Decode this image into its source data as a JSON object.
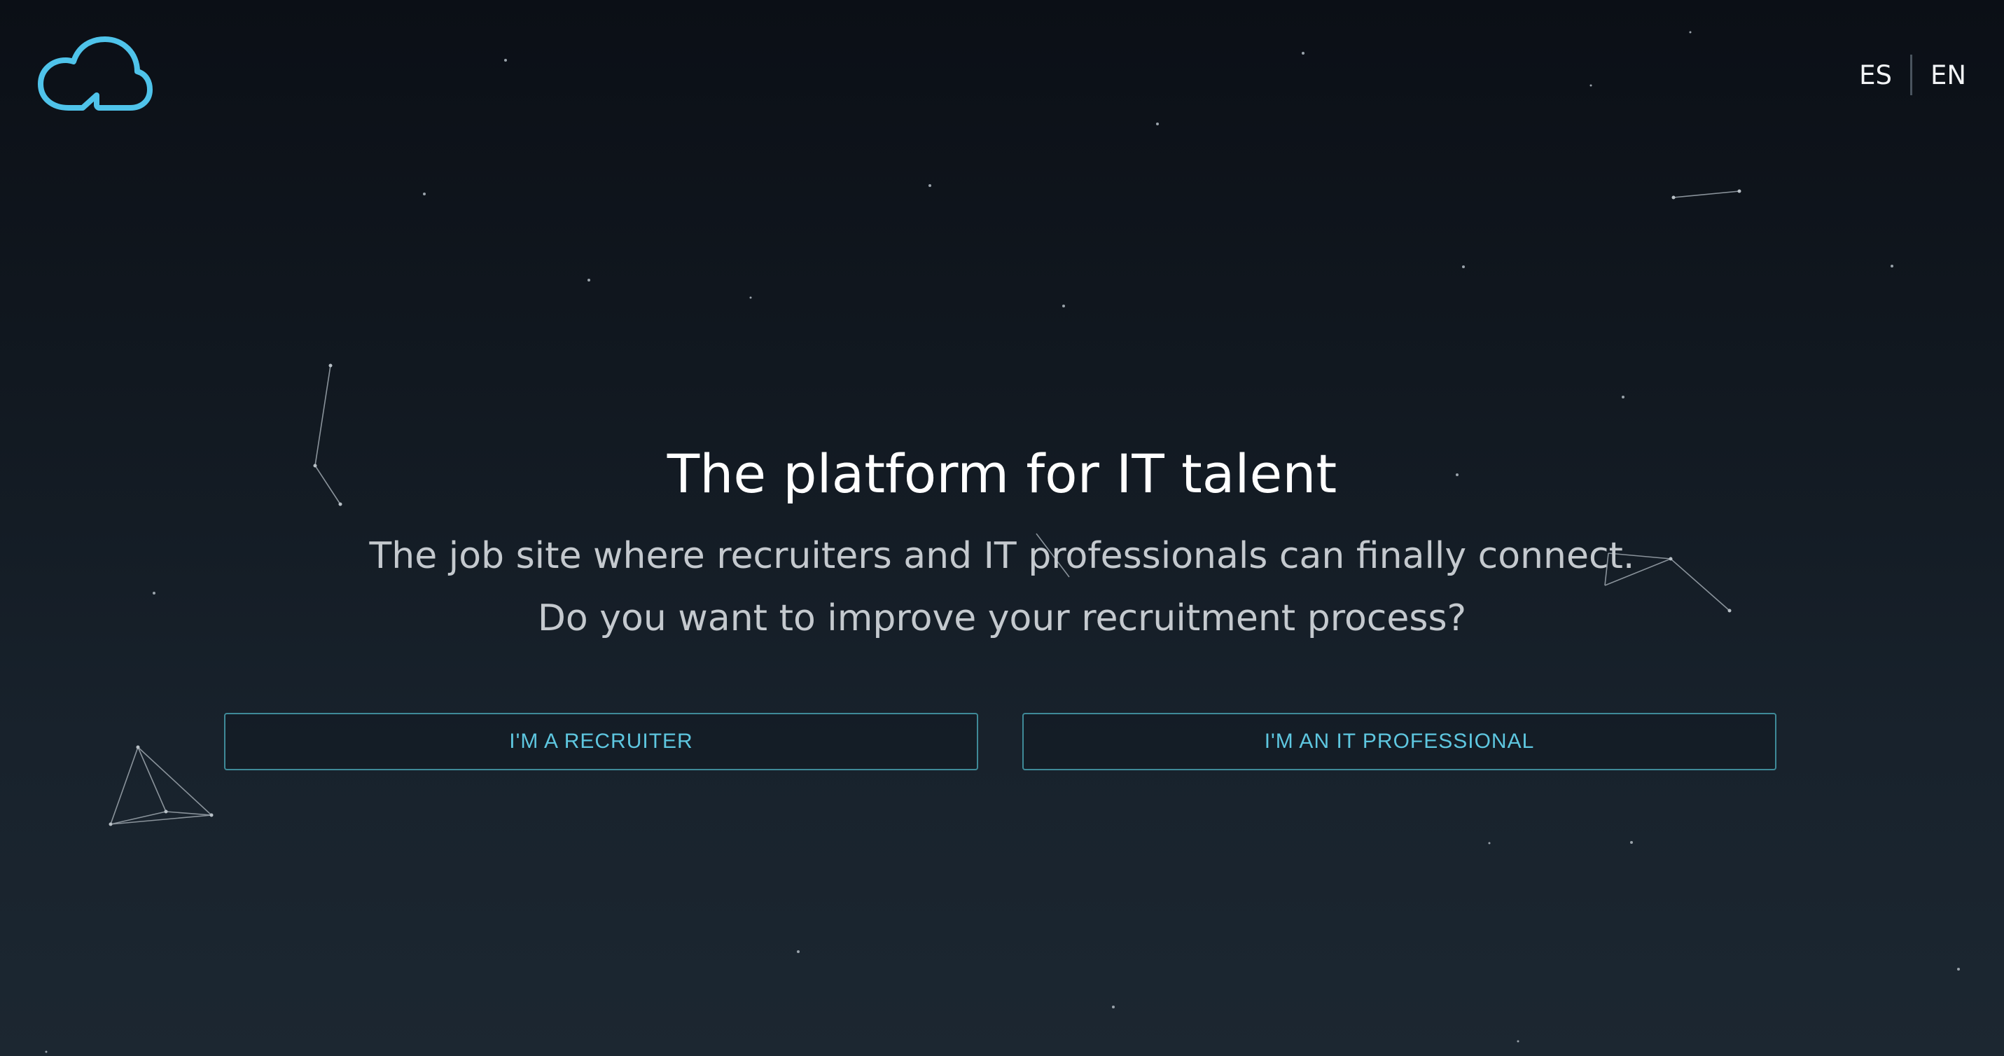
{
  "header": {
    "logo_icon": "cloud-logo-icon",
    "languages": [
      {
        "code": "ES",
        "label": "ES"
      },
      {
        "code": "EN",
        "label": "EN"
      }
    ]
  },
  "hero": {
    "title": "The platform for IT talent",
    "subtitle_line1": "The job site where recruiters and IT professionals can finally connect.",
    "subtitle_line2": "Do you want to improve your recruitment process?"
  },
  "actions": {
    "recruiter_label": "I'M A RECRUITER",
    "professional_label": "I'M AN IT PROFESSIONAL"
  },
  "colors": {
    "accent": "#5ec7e0",
    "logo": "#4fc3ea",
    "button_border": "#3f8a98",
    "background_top": "#0b0f16",
    "background_bottom": "#1c2731"
  }
}
